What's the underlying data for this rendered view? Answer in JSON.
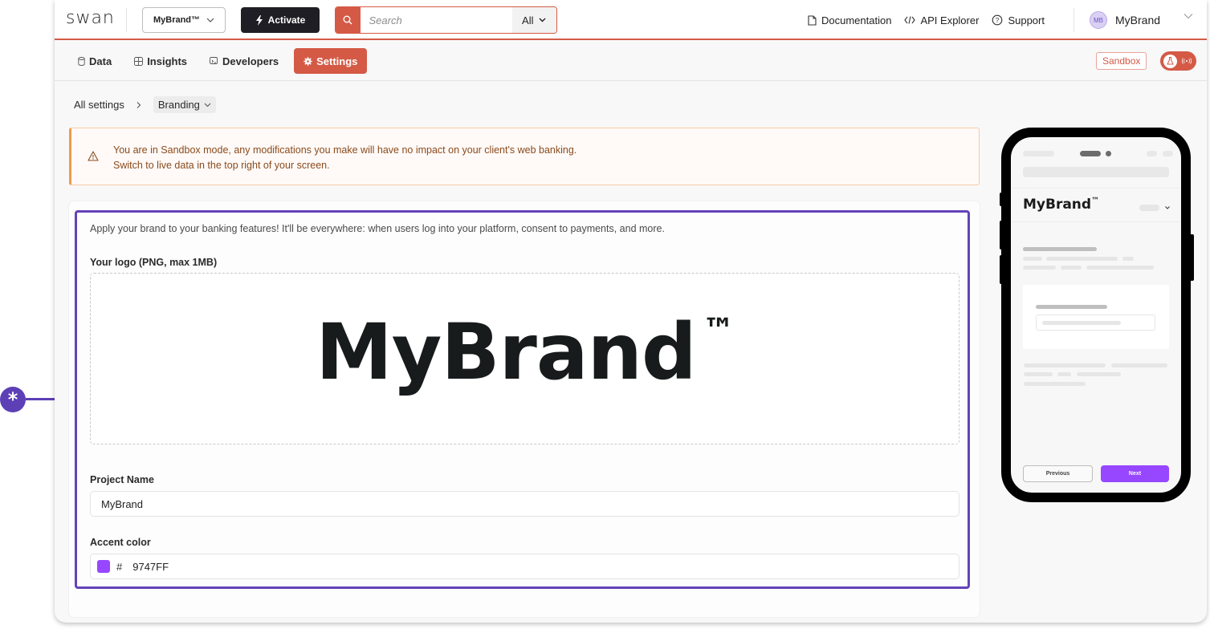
{
  "topbar": {
    "logo": "swan",
    "project_select": "MyBrand™",
    "activate_label": "Activate",
    "search": {
      "placeholder": "Search",
      "value": "",
      "filter": "All"
    },
    "links": [
      {
        "label": "Documentation",
        "icon": "document-icon"
      },
      {
        "label": "API Explorer",
        "icon": "code-icon"
      },
      {
        "label": "Support",
        "icon": "support-icon"
      }
    ],
    "user": {
      "initials": "MB",
      "name": "MyBrand"
    }
  },
  "nav": {
    "tabs": [
      {
        "label": "Data",
        "icon": "database-icon",
        "active": false
      },
      {
        "label": "Insights",
        "icon": "insights-icon",
        "active": false
      },
      {
        "label": "Developers",
        "icon": "developers-icon",
        "active": false
      },
      {
        "label": "Settings",
        "icon": "gear-icon",
        "active": true
      }
    ],
    "environment_badge": "Sandbox",
    "environment_toggle": "sandbox"
  },
  "breadcrumb": {
    "root": "All settings",
    "current": "Branding"
  },
  "alert": {
    "line1": "You are in Sandbox mode, any modifications you make will have no impact on your client's web banking.",
    "line2": "Switch to live data in the top right of your screen."
  },
  "branding": {
    "intro": "Apply your brand to your banking features! It'll be everywhere: when users log into your platform, consent to payments, and more.",
    "logo_label": "Your logo (PNG, max 1MB)",
    "logo_text": "MyBrand",
    "logo_tm": "™",
    "project_name_label": "Project Name",
    "project_name_value": "MyBrand",
    "accent_label": "Accent color",
    "accent_hash": "#",
    "accent_value": "9747FF",
    "accent_hex": "#9747FF"
  },
  "preview": {
    "brand": "MyBrand",
    "brand_tm": "™",
    "previous_label": "Previous",
    "next_label": "Next"
  },
  "annotation": {
    "marker": "*"
  },
  "colors": {
    "brand_red": "#D45A46",
    "highlight": "#6443B8",
    "accent": "#9747FF"
  }
}
